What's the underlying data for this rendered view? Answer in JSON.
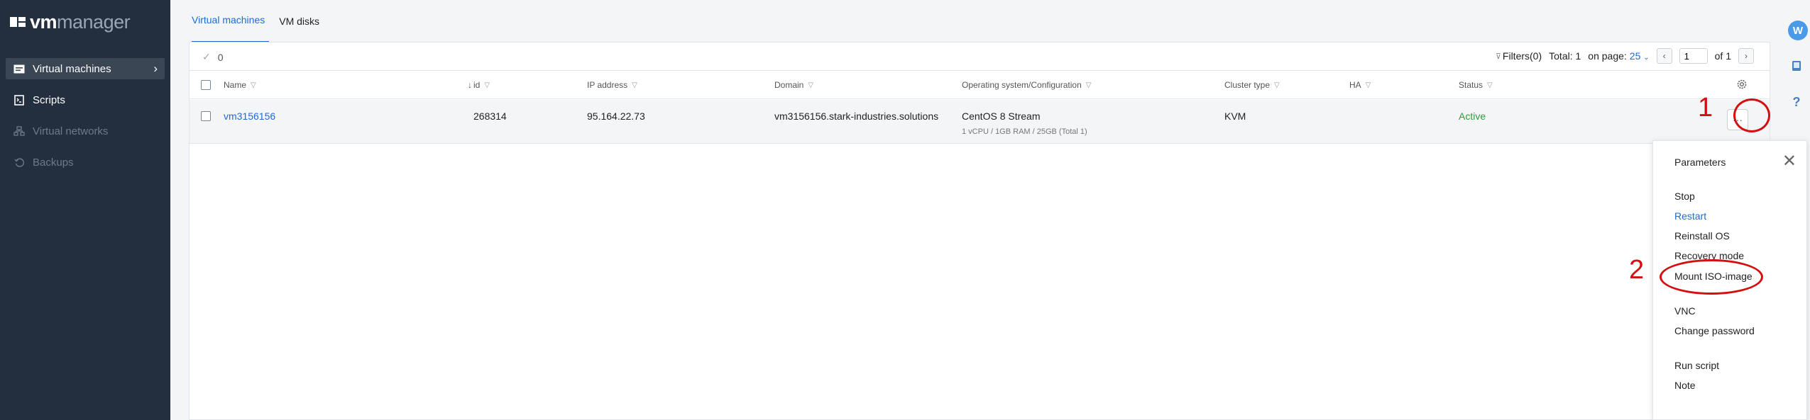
{
  "brand": {
    "vm": "vm",
    "manager": "manager"
  },
  "sidebar": {
    "items": [
      {
        "label": "Virtual machines",
        "icon": "virtual-machines-icon",
        "state": "active"
      },
      {
        "label": "Scripts",
        "icon": "scripts-icon",
        "state": "normal"
      },
      {
        "label": "Virtual networks",
        "icon": "network-icon",
        "state": "disabled"
      },
      {
        "label": "Backups",
        "icon": "backup-icon",
        "state": "disabled"
      }
    ]
  },
  "tabs": [
    {
      "label": "Virtual machines",
      "active": true
    },
    {
      "label": "VM disks",
      "active": false
    }
  ],
  "toolbar": {
    "selected_count": "0",
    "filters": "Filters(0)",
    "total": "Total: 1",
    "on_page_label": "on page:",
    "on_page_value": "25",
    "page_value": "1",
    "of_label": "of 1"
  },
  "columns": [
    "Name",
    "id",
    "IP address",
    "Domain",
    "Operating system/Configuration",
    "Cluster type",
    "HA",
    "Status"
  ],
  "rows": [
    {
      "name": "vm3156156",
      "id": "268314",
      "ip": "95.164.22.73",
      "domain": "vm3156156.stark-industries.solutions",
      "os": "CentOS 8 Stream",
      "config": "1 vCPU / 1GB RAM / 25GB (Total 1)",
      "cluster": "KVM",
      "ha": "",
      "status": "Active"
    }
  ],
  "menu": {
    "title": "Parameters",
    "items": [
      "Stop",
      "Restart",
      "Reinstall OS",
      "Recovery mode",
      "Mount ISO-image",
      "VNC",
      "Change password",
      "Run script",
      "Note"
    ]
  },
  "rail": {
    "avatar": "W",
    "help": "?"
  },
  "annotations": {
    "one": "1",
    "two": "2"
  },
  "colors": {
    "sidebar": "#232f3e",
    "accent": "#1e6bd6",
    "active_status": "#2e9c3a",
    "annotation": "#d40f0f"
  }
}
